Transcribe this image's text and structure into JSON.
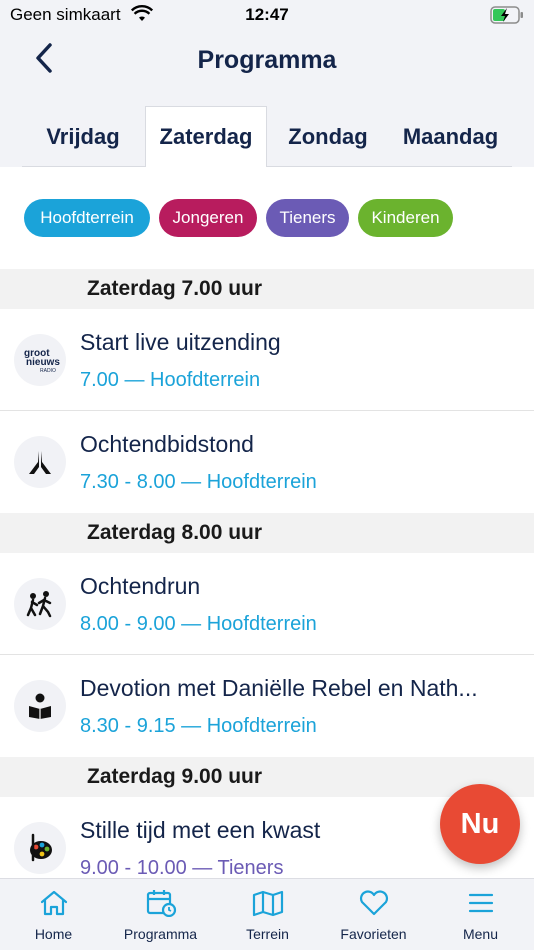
{
  "status_bar": {
    "carrier": "Geen simkaart",
    "time": "12:47"
  },
  "nav": {
    "title": "Programma"
  },
  "tabs": [
    {
      "label": "Vrijdag",
      "active": false
    },
    {
      "label": "Zaterdag",
      "active": true
    },
    {
      "label": "Zondag",
      "active": false
    },
    {
      "label": "Maandag",
      "active": false
    }
  ],
  "filters": [
    {
      "label": "Hoofdterrein",
      "color": "#1ba3d9"
    },
    {
      "label": "Jongeren",
      "color": "#b81c5e"
    },
    {
      "label": "Tieners",
      "color": "#6b5bb5"
    },
    {
      "label": "Kinderen",
      "color": "#6bb32e"
    }
  ],
  "schedule": [
    {
      "header": "Zaterdag 7.00 uur",
      "items": [
        {
          "title": "Start live uitzending",
          "subtitle": "7.00 — Hoofdterrein",
          "icon": "radio-logo-icon",
          "logo_text": [
            "groot",
            "nieuws",
            "RADIO"
          ]
        },
        {
          "title": "Ochtendbidstond",
          "subtitle": "7.30 - 8.00 — Hoofdterrein",
          "icon": "praying-hands-icon"
        }
      ]
    },
    {
      "header": "Zaterdag 8.00 uur",
      "items": [
        {
          "title": "Ochtendrun",
          "subtitle": "8.00 - 9.00 — Hoofdterrein",
          "icon": "running-icon"
        },
        {
          "title": "Devotion met Daniëlle Rebel en Nath...",
          "subtitle": "8.30 - 9.15 — Hoofdterrein",
          "icon": "reading-icon"
        }
      ]
    },
    {
      "header": "Zaterdag 9.00 uur",
      "items": [
        {
          "title": "Stille tijd met een kwast",
          "subtitle": "9.00 - 10.00 — Tieners",
          "icon": "palette-icon"
        }
      ]
    }
  ],
  "fab": {
    "label": "Nu"
  },
  "tabbar": [
    {
      "label": "Home",
      "icon": "home-icon"
    },
    {
      "label": "Programma",
      "icon": "calendar-icon"
    },
    {
      "label": "Terrein",
      "icon": "map-icon"
    },
    {
      "label": "Favorieten",
      "icon": "heart-icon"
    },
    {
      "label": "Menu",
      "icon": "menu-icon"
    }
  ],
  "colors": {
    "navy": "#14254a",
    "accent_blue": "#1ba3d9",
    "fab_red": "#e84a34",
    "header_bg": "#f2f3f7"
  }
}
